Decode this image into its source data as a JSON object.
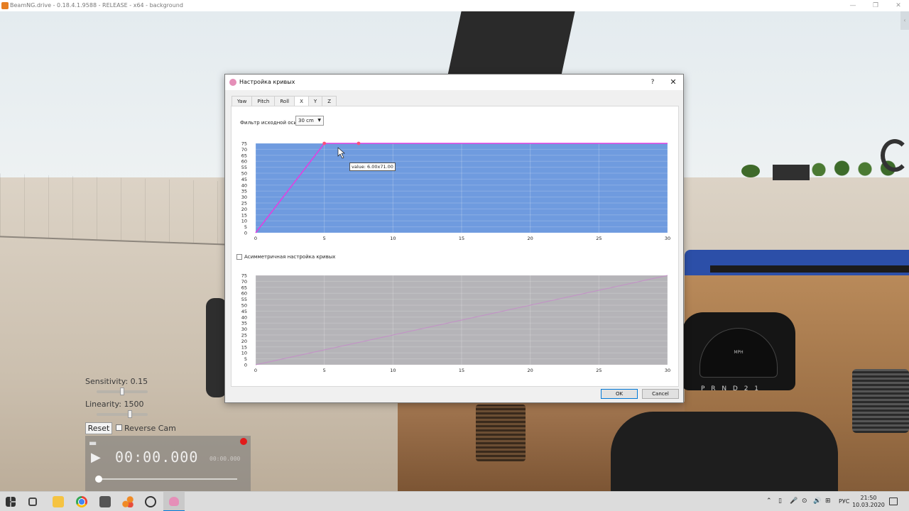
{
  "window": {
    "title": "BeamNG.drive - 0.18.4.1.9588 - RELEASE - x64 - background"
  },
  "overlay": {
    "sensitivity_label": "Sensitivity: 0.15",
    "linearity_label": "Linearity: 1500",
    "reset_label": "Reset",
    "reverse_cam_label": "Reverse Cam",
    "reverse_cam_checked": false
  },
  "replay": {
    "time": "00:00.000",
    "time_total": "00:00.000",
    "folder_icon": "folder-icon",
    "play_icon": "play-icon",
    "record_color": "#e21b1b"
  },
  "dashboard": {
    "gear_indicator": "P R N D 2 1",
    "speed_unit": "MPH"
  },
  "dialog": {
    "title": "Настройка кривых",
    "help_label": "?",
    "close_label": "✕",
    "tabs": [
      {
        "label": "Yaw",
        "active": false
      },
      {
        "label": "Pitch",
        "active": false
      },
      {
        "label": "Roll",
        "active": false
      },
      {
        "label": "X",
        "active": true
      },
      {
        "label": "Y",
        "active": false
      },
      {
        "label": "Z",
        "active": false
      }
    ],
    "filter_label": "Фильтр исходной оси",
    "filter_value": "30 cm",
    "tooltip": "value: 6.00x71.00",
    "asymmetric_label": "Асимметричная настройка кривых",
    "asymmetric_checked": false,
    "ok_label": "OK",
    "cancel_label": "Cancel",
    "accent_color": "#0078d7"
  },
  "chart_data": [
    {
      "type": "line",
      "xlim": [
        0,
        30
      ],
      "ylim": [
        0,
        75
      ],
      "x_ticks": [
        "0",
        "5",
        "10",
        "15",
        "20",
        "25",
        "30"
      ],
      "y_ticks": [
        "0",
        "5",
        "10",
        "15",
        "20",
        "25",
        "30",
        "35",
        "40",
        "45",
        "50",
        "55",
        "60",
        "65",
        "70",
        "75"
      ],
      "series": [
        {
          "points": [
            [
              0,
              0
            ],
            [
              5,
              75
            ],
            [
              7.5,
              75
            ],
            [
              30,
              75
            ]
          ],
          "color": "#e040e0"
        }
      ],
      "control_points": [
        [
          5,
          75
        ],
        [
          7.5,
          75
        ]
      ],
      "background": "#6f9bdf",
      "grid": true
    },
    {
      "type": "line",
      "xlim": [
        0,
        30
      ],
      "ylim": [
        0,
        75
      ],
      "x_ticks": [
        "0",
        "5",
        "10",
        "15",
        "20",
        "25",
        "30"
      ],
      "y_ticks": [
        "0",
        "5",
        "10",
        "15",
        "20",
        "25",
        "30",
        "35",
        "40",
        "45",
        "50",
        "55",
        "60",
        "65",
        "70",
        "75"
      ],
      "series": [
        {
          "points": [
            [
              0,
              0
            ],
            [
              30,
              75
            ]
          ],
          "color": "#c48fc8"
        }
      ],
      "background": "#b5b4b8",
      "grid": true
    }
  ],
  "taskbar": {
    "language": "РУС",
    "time": "21:50",
    "date": "10.03.2020"
  }
}
